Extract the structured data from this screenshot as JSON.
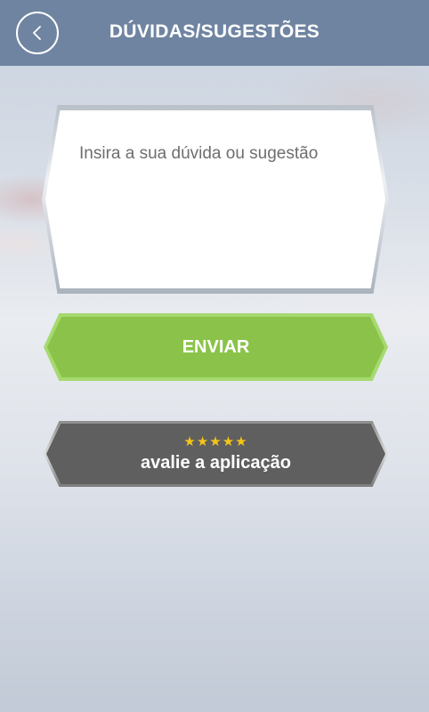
{
  "header": {
    "title": "DÚVIDAS/SUGESTÕES",
    "back_icon": "chevron-left-icon",
    "color": "#6f84a1"
  },
  "form": {
    "message_placeholder": "Insira a sua dúvida ou sugestão",
    "message_value": "",
    "send_label": "ENVIAR",
    "send_color": "#8bc34a"
  },
  "rating": {
    "stars": "★★★★★",
    "star_count": 5,
    "star_color": "#f5c518",
    "label": "avalie a aplicação"
  }
}
